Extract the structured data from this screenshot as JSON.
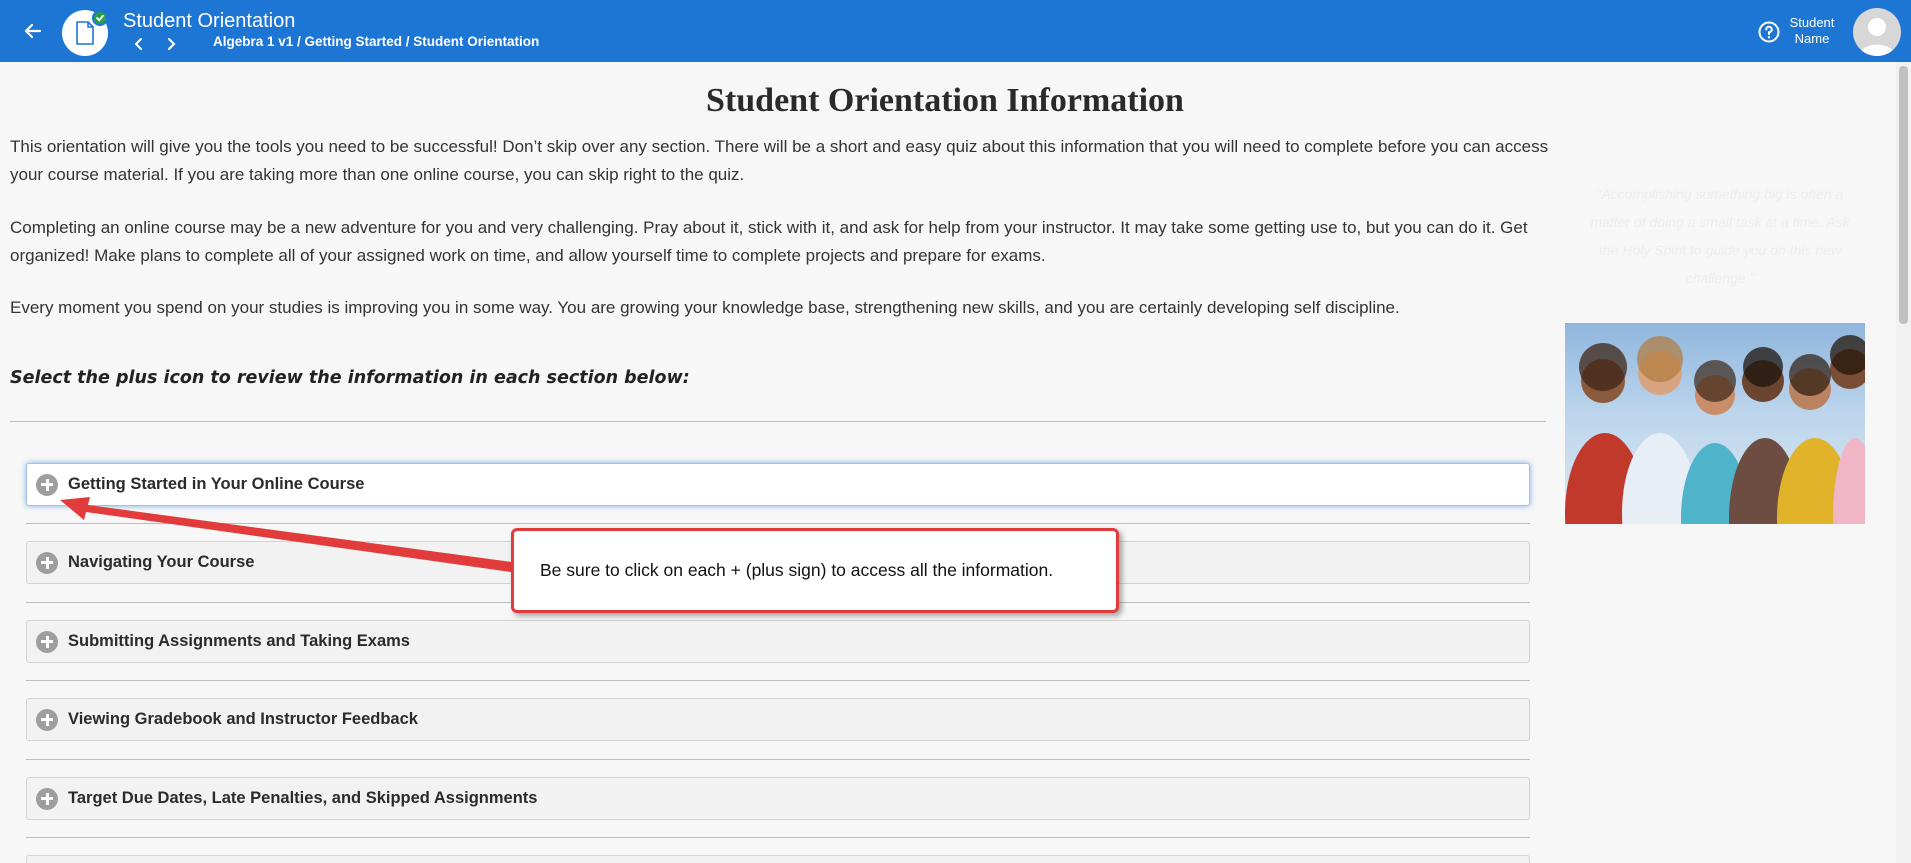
{
  "header": {
    "title": "Student Orientation",
    "breadcrumb": "Algebra 1 v1 / Getting Started / Student Orientation",
    "user_name_line1": "Student",
    "user_name_line2": "Name",
    "colors": {
      "bar": "#1e76d4",
      "check": "#2e9e4b"
    }
  },
  "main": {
    "heading": "Student Orientation Information",
    "paragraphs": [
      "This orientation will give you the tools you need to be successful! Don’t skip over any section. There will be a short and easy quiz about this information that you will need to complete before you can access your course material. If you are taking more than one online course, you can skip right to the quiz.",
      "Completing an online course may be a new adventure for you and very challenging. Pray about it, stick with it, and ask for help from your instructor. It may take some getting use to, but you can do it. Get organized! Make plans to complete all of your assigned work on time, and allow yourself time to complete projects and prepare for exams.",
      "Every moment you spend on your studies is improving you in some way. You are growing your knowledge base, strengthening new skills, and you are certainly developing self discipline."
    ],
    "instruction": "Select the plus icon to review the information in each section below:",
    "sections": [
      {
        "label": "Getting Started in Your Online Course",
        "icon": "plus-circle-icon"
      },
      {
        "label": "Navigating Your Course",
        "icon": "plus-circle-icon"
      },
      {
        "label": "Submitting Assignments and Taking Exams",
        "icon": "plus-circle-icon"
      },
      {
        "label": "Viewing Gradebook and Instructor Feedback",
        "icon": "plus-circle-icon"
      },
      {
        "label": "Target Due Dates, Late Penalties, and Skipped Assignments",
        "icon": "plus-circle-icon"
      }
    ]
  },
  "callout": {
    "text": "Be sure to click on each + (plus sign) to access all the information.",
    "border_color": "#e23b3b"
  },
  "sidebar": {
    "quote": "“Accomplishing something big is often a matter of doing a small task at a time. Ask the Holy Spirit to guide you on this new challenge.”"
  }
}
